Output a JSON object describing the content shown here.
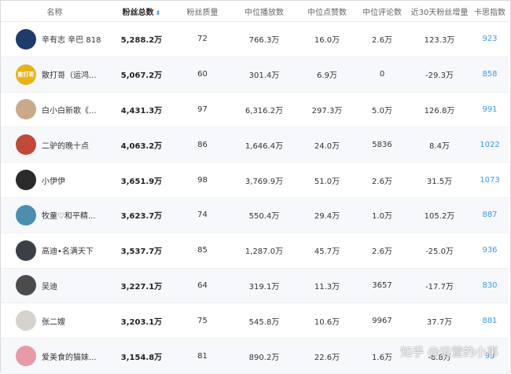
{
  "headers": {
    "name": "名称",
    "fans_total": "粉丝总数",
    "fans_quality": "粉丝质量",
    "median_plays": "中位播放数",
    "median_likes": "中位点赞数",
    "median_comments": "中位评论数",
    "growth_30d": "近30天粉丝增量",
    "kasi_index": "卡思指数"
  },
  "sort_icon": "sort-desc-icon",
  "rows": [
    {
      "name": "辛有志 辛巴 818",
      "avatar_color": "#1f3a6b",
      "avatar_text": "",
      "fans": "5,288.2万",
      "quality": "72",
      "plays": "766.3万",
      "likes": "16.0万",
      "comments": "2.6万",
      "growth": "123.3万",
      "kasi": "923"
    },
    {
      "name": "散打哥（运鸿...",
      "avatar_color": "#e8b21a",
      "avatar_text": "散打哥",
      "fans": "5,067.2万",
      "quality": "60",
      "plays": "301.4万",
      "likes": "6.9万",
      "comments": "0",
      "growth": "-29.3万",
      "kasi": "858"
    },
    {
      "name": "白小白新歌《...",
      "avatar_color": "#c9a98a",
      "avatar_text": "",
      "fans": "4,431.3万",
      "quality": "97",
      "plays": "6,316.2万",
      "likes": "297.3万",
      "comments": "5.0万",
      "growth": "126.8万",
      "kasi": "991"
    },
    {
      "name": "二驴的晚十点",
      "avatar_color": "#c04a3a",
      "avatar_text": "",
      "fans": "4,063.2万",
      "quality": "86",
      "plays": "1,646.4万",
      "likes": "24.0万",
      "comments": "5836",
      "growth": "8.4万",
      "kasi": "1022"
    },
    {
      "name": "小伊伊",
      "avatar_color": "#2a2a2a",
      "avatar_text": "",
      "fans": "3,651.9万",
      "quality": "98",
      "plays": "3,769.9万",
      "likes": "51.0万",
      "comments": "2.6万",
      "growth": "31.5万",
      "kasi": "1073"
    },
    {
      "name": "牧童♡和平精...",
      "avatar_color": "#4a8fb0",
      "avatar_text": "",
      "fans": "3,623.7万",
      "quality": "74",
      "plays": "550.4万",
      "likes": "29.4万",
      "comments": "1.0万",
      "growth": "105.2万",
      "kasi": "887"
    },
    {
      "name": "高迪•名满天下",
      "avatar_color": "#3a3f48",
      "avatar_text": "",
      "fans": "3,537.7万",
      "quality": "85",
      "plays": "1,287.0万",
      "likes": "45.7万",
      "comments": "2.6万",
      "growth": "-25.0万",
      "kasi": "936"
    },
    {
      "name": "吴迪",
      "avatar_color": "#4b4b4b",
      "avatar_text": "",
      "fans": "3,227.1万",
      "quality": "64",
      "plays": "319.1万",
      "likes": "11.3万",
      "comments": "3657",
      "growth": "-17.7万",
      "kasi": "830"
    },
    {
      "name": "张二嫂",
      "avatar_color": "#d7d2cc",
      "avatar_text": "",
      "fans": "3,203.1万",
      "quality": "75",
      "plays": "545.8万",
      "likes": "10.6万",
      "comments": "9967",
      "growth": "37.7万",
      "kasi": "881"
    },
    {
      "name": "爱美食的猫妹...",
      "avatar_color": "#e89aa8",
      "avatar_text": "",
      "fans": "3,154.8万",
      "quality": "81",
      "plays": "890.2万",
      "likes": "22.6万",
      "comments": "1.6万",
      "growth": "-6.8万",
      "kasi": "93"
    }
  ],
  "watermark": "知乎 @运营的小事"
}
